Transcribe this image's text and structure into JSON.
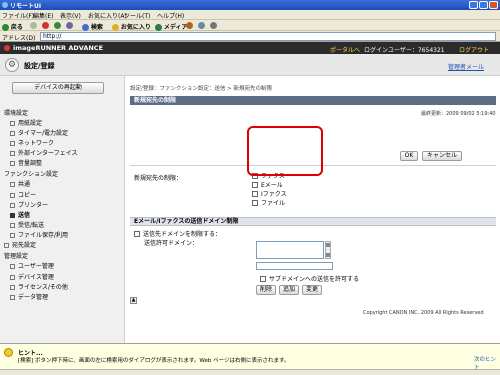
{
  "window": {
    "title": "リモートUI"
  },
  "menubar": [
    "ファイル(F)",
    "編集(E)",
    "表示(V)",
    "お気に入り(A)",
    "ツール(T)",
    "ヘルプ(H)"
  ],
  "toolbar": {
    "back": "戻る",
    "search": "検索",
    "favorites": "お気に入り",
    "media": "メディア"
  },
  "address": {
    "label": "アドレス(D)",
    "url": "http://"
  },
  "topbar": {
    "brand": "imageRUNNER ADVANCE",
    "portal": "ポータルへ",
    "user": "ログインユーザー：7654321",
    "logout": "ログアウト"
  },
  "header": {
    "title": "設定/登録",
    "mgmt": "管理者メール"
  },
  "sidebar": {
    "device_button": "デバイスの再起動",
    "items": [
      {
        "label": "環境設定",
        "type": "cat"
      },
      {
        "label": "用紙設定",
        "type": "sub"
      },
      {
        "label": "タイマー/電力設定",
        "type": "sub"
      },
      {
        "label": "ネットワーク",
        "type": "sub"
      },
      {
        "label": "外部インターフェイス",
        "type": "sub"
      },
      {
        "label": "音量調整",
        "type": "sub"
      },
      {
        "label": "ファンクション設定",
        "type": "cat"
      },
      {
        "label": "共通",
        "type": "sub"
      },
      {
        "label": "コピー",
        "type": "sub"
      },
      {
        "label": "プリンター",
        "type": "sub"
      },
      {
        "label": "送信",
        "type": "sub-sel"
      },
      {
        "label": "受信/転送",
        "type": "sub"
      },
      {
        "label": "ファイル保存/利用",
        "type": "sub"
      },
      {
        "label": "宛先設定",
        "type": "sub"
      },
      {
        "label": "管理設定",
        "type": "cat"
      },
      {
        "label": "ユーザー管理",
        "type": "sub"
      },
      {
        "label": "デバイス管理",
        "type": "sub"
      },
      {
        "label": "ライセンス/その他",
        "type": "sub"
      },
      {
        "label": "データ管理",
        "type": "sub"
      }
    ]
  },
  "main": {
    "breadcrumb": "設定/登録：ファンクション設定：送信 > 新規宛先の制限",
    "panel_title": "新規宛先の制限",
    "datetime": "最終更新：2009 09/02 5:19:40",
    "ok": "OK",
    "cancel": "キャンセル",
    "field_label": "新規宛先の制限：",
    "options": [
      "ファクス",
      "Eメール",
      "Iファクス",
      "ファイル"
    ],
    "section2_title": "Eメール/Iファクスの送信ドメイン制限",
    "restrict_domain": "送信先ドメインを制限する：",
    "allowed_domain": "送信許可ドメイン：",
    "subdomain": "サブドメインへの送信を許可する",
    "delete": "削除",
    "add": "追加",
    "edit": "変更"
  },
  "footer": {
    "copyright": "Copyright CANON INC. 2009 All Rights Reserved"
  },
  "hint": {
    "title": "ヒント...",
    "body": "[検索] ボタン押下時に、画面の左に検索用のダイアログが表示されます。Web ページは右側に表示されます。",
    "next": "次のヒント"
  }
}
